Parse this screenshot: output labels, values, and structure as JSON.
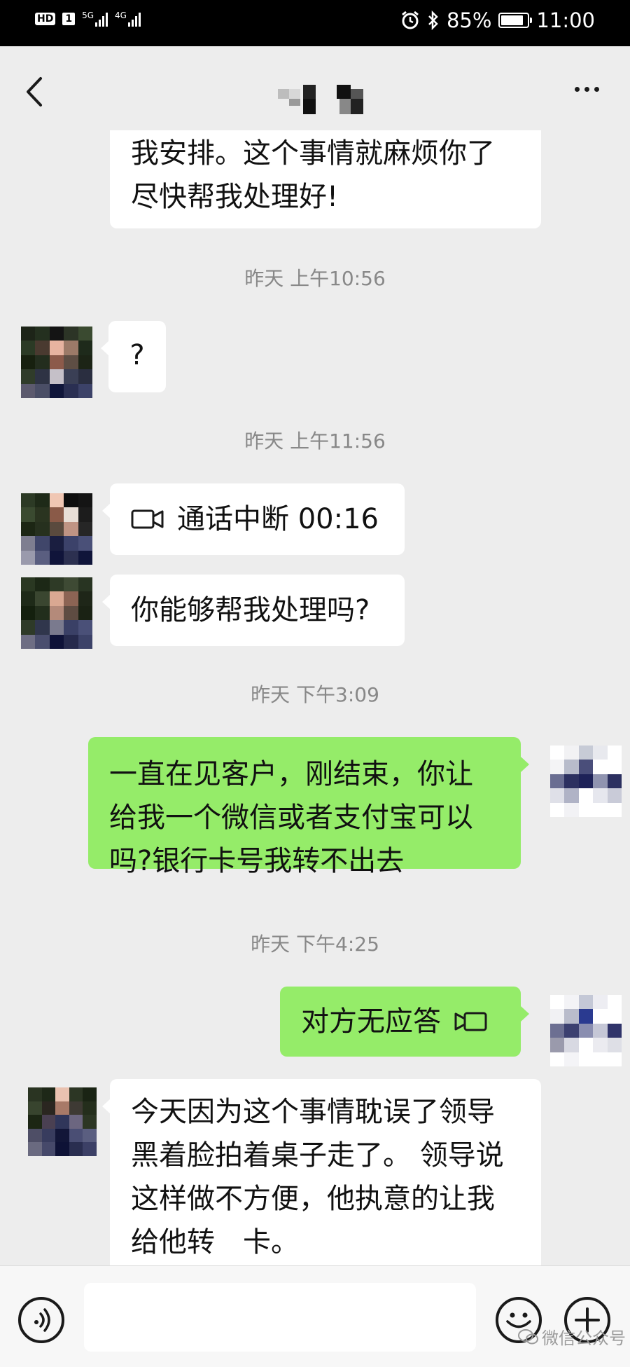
{
  "status_bar": {
    "hd": "HD",
    "sim": "1",
    "network_1": "5G",
    "network_2": "4G",
    "battery": "85%",
    "battery_level": 0.85,
    "time": "11:00"
  },
  "header": {
    "title": "",
    "back_icon": "back-chevron-icon",
    "more_icon": "more-dots-icon"
  },
  "messages": [
    {
      "type": "incoming",
      "lines": [
        "我安排。这个事情就麻烦你了",
        "尽快帮我处理好!"
      ]
    },
    {
      "type": "timestamp",
      "text": "昨天 上午10:56"
    },
    {
      "type": "incoming",
      "lines": [
        "?"
      ]
    },
    {
      "type": "timestamp",
      "text": "昨天 上午11:56"
    },
    {
      "type": "call",
      "text": "通话中断 00:16",
      "icon": "video-call-icon"
    },
    {
      "type": "incoming",
      "lines": [
        "你能够帮我处理吗?"
      ]
    },
    {
      "type": "timestamp",
      "text": "昨天 下午3:09"
    },
    {
      "type": "outgoing",
      "lines": [
        "一直在见客户，刚结束，你让",
        "给我一个微信或者支付宝可以",
        "吗?银行卡号我转不出去"
      ]
    },
    {
      "type": "timestamp",
      "text": "昨天 下午4:25"
    },
    {
      "type": "outgoing-call",
      "text": "对方无应答",
      "icon": "video-call-icon"
    },
    {
      "type": "incoming",
      "lines": [
        "今天因为这个事情耽误了领导",
        "黑着脸拍着桌子走了。 领导说",
        "这样做不方便，他执意的让我",
        "给他转　卡。"
      ]
    }
  ],
  "input_bar": {
    "voice_icon": "voice-icon",
    "emoji_icon": "emoji-icon",
    "plus_icon": "plus-icon",
    "placeholder": ""
  },
  "watermark": "微信公众号",
  "colors": {
    "background": "#ededed",
    "outgoing_bubble": "#95ec69",
    "incoming_bubble": "#ffffff",
    "timestamp": "#888888"
  }
}
